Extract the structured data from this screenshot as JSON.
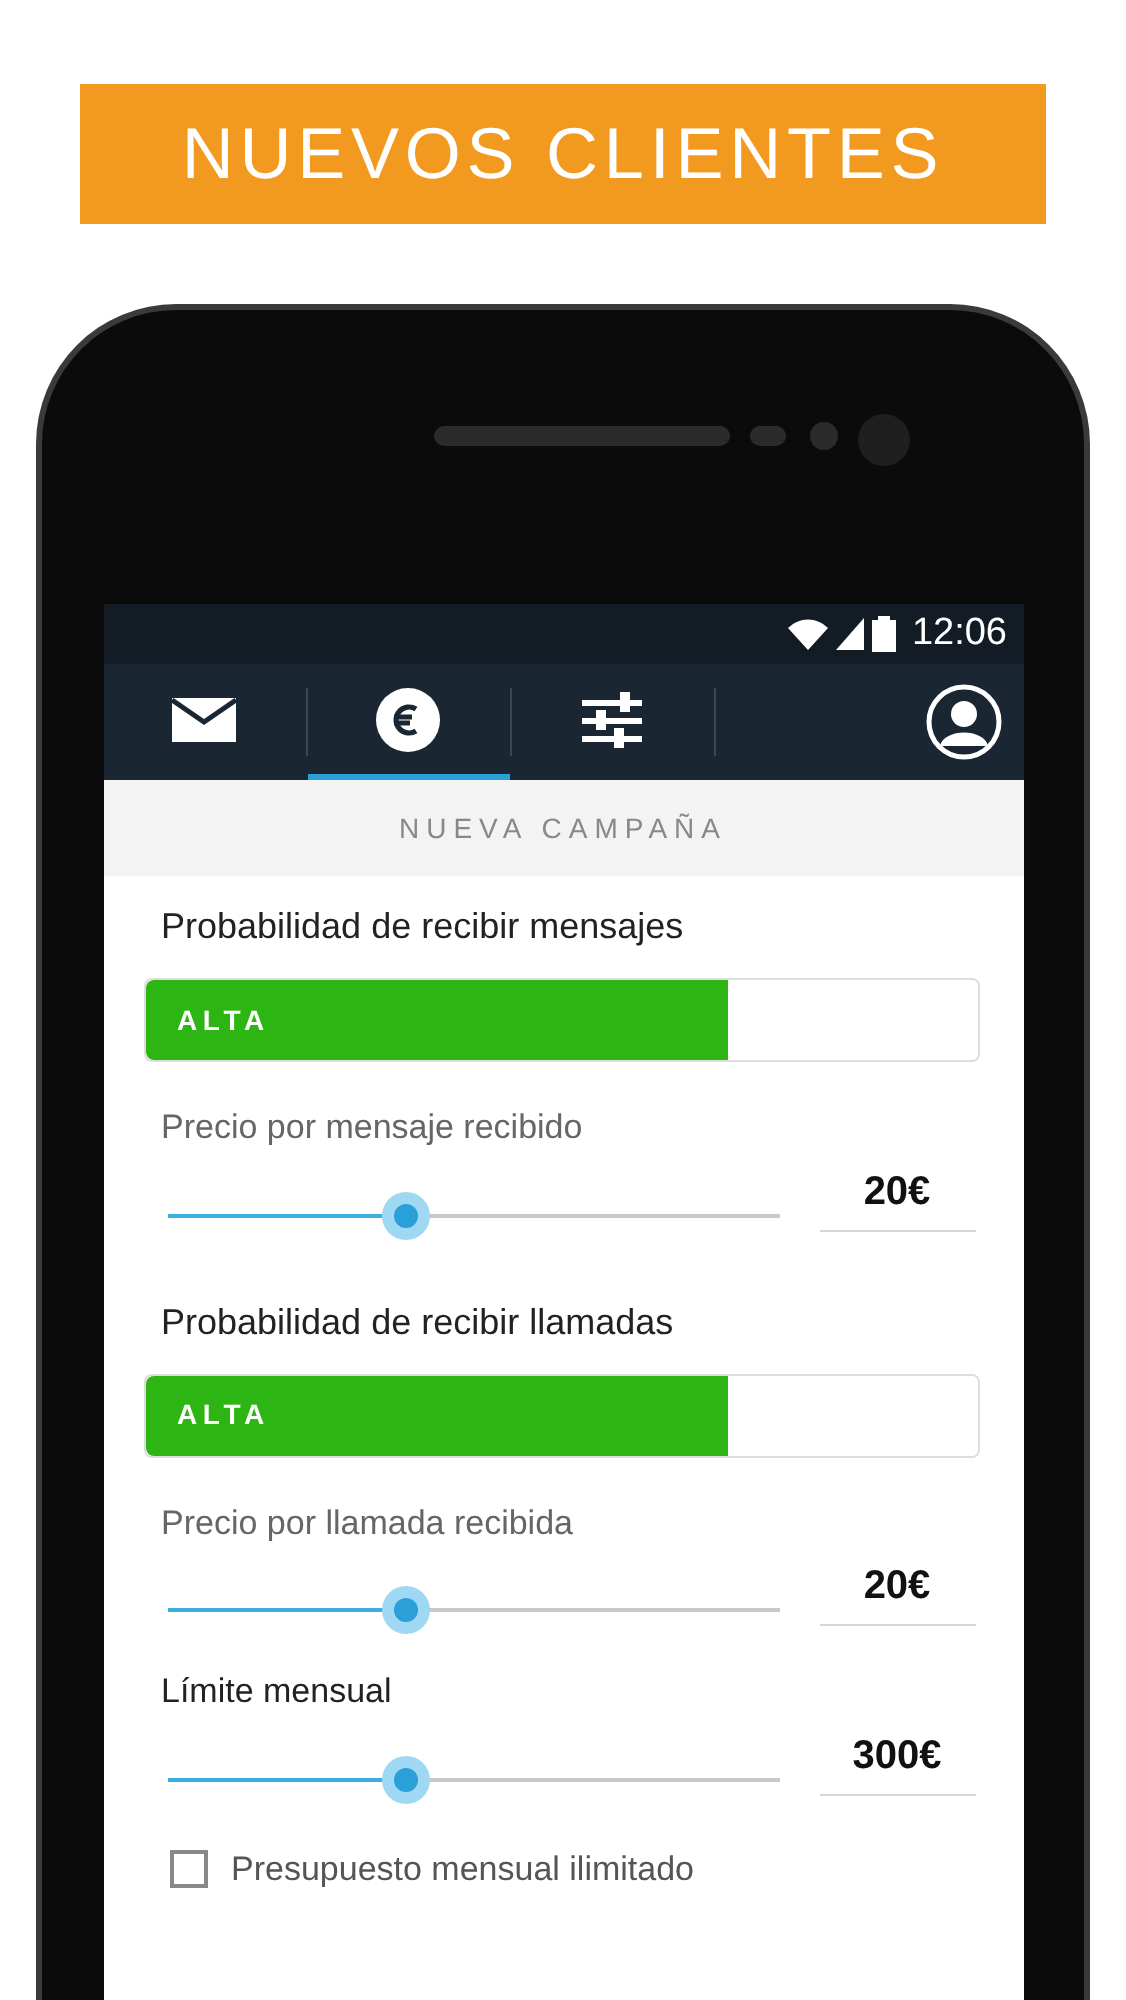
{
  "banner": {
    "title": "NUEVOS CLIENTES"
  },
  "status_bar": {
    "time": "12:06"
  },
  "tabs": [
    {
      "selected": false
    },
    {
      "selected": true
    },
    {
      "selected": false
    }
  ],
  "header": {
    "title": "NUEVA CAMPAÑA"
  },
  "form": [
    {
      "kind": "meter",
      "label": "Probabilidad de recibir mensajes",
      "meter_label": "ALTA",
      "level": 0.7
    },
    {
      "kind": "slider",
      "label": "Precio por mensaje recibido",
      "level": 0.39,
      "value": "20€",
      "strong": false
    },
    {
      "kind": "meter",
      "label": "Probabilidad de recibir llamadas",
      "meter_label": "ALTA",
      "level": 0.7
    },
    {
      "kind": "slider",
      "label": "Precio por llamada recibida",
      "level": 0.39,
      "value": "20€",
      "strong": false
    },
    {
      "kind": "slider",
      "label": "Límite mensual",
      "level": 0.39,
      "value": "300€",
      "strong": true
    },
    {
      "kind": "checkbox",
      "label": "Presupuesto mensual ilimitado",
      "checked": false
    }
  ]
}
